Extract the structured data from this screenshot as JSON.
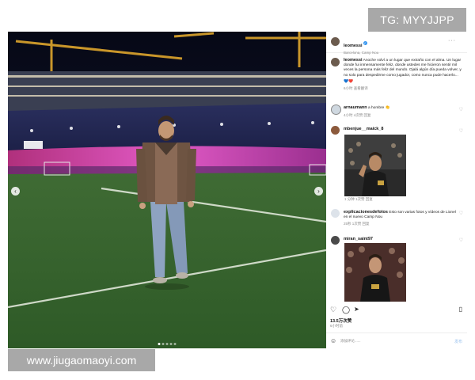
{
  "watermarks": {
    "top": "TG: MYYJJPP",
    "bottom": "www.jiugaomaoyi.com"
  },
  "post": {
    "username": "leomessi",
    "location": "Barcelona, Camp Nou",
    "more": "···",
    "caption": "Anoche volví a un lugar que extraño con el alma. Un lugar donde fui inmensamente feliz, donde ustedes me hicieron sentir mil veces la persona más feliz del mundo. Ojalá algún día pueda volver, y no solo para despedirme como jugador, como nunca pude hacerlo...",
    "caption_emoji": "💙❤️",
    "caption_meta": "6小时 查看翻译",
    "likes": "13.5万次赞",
    "date": "6小时前",
    "comment_placeholder": "添加评论......",
    "comment_post": "发布"
  },
  "comments": [
    {
      "user": "arnaumann",
      "text": "a hombre 👏",
      "meta": "4小时  4次赞  回复"
    },
    {
      "user": "mbenjue__maick_8",
      "text": "",
      "meta": "1 分钟  1次赞  回复"
    },
    {
      "user": "explicacionesdefotos",
      "text": "Esto son varias fotos y vídeos de Lionel en el nuevo Camp Nou",
      "meta": "25秒  1次赞  回复"
    },
    {
      "user": "miran_saint97",
      "text": "",
      "meta": ""
    }
  ],
  "icons": {
    "verified": "verified-badge-icon",
    "heart": "heart-icon",
    "comment": "comment-icon",
    "share": "share-icon",
    "save": "bookmark-icon",
    "emoji": "emoji-icon",
    "prev": "chevron-left-icon",
    "next": "chevron-right-icon"
  },
  "colors": {
    "accent": "#3897f0",
    "watermark_bg": "#a8a8a8"
  }
}
